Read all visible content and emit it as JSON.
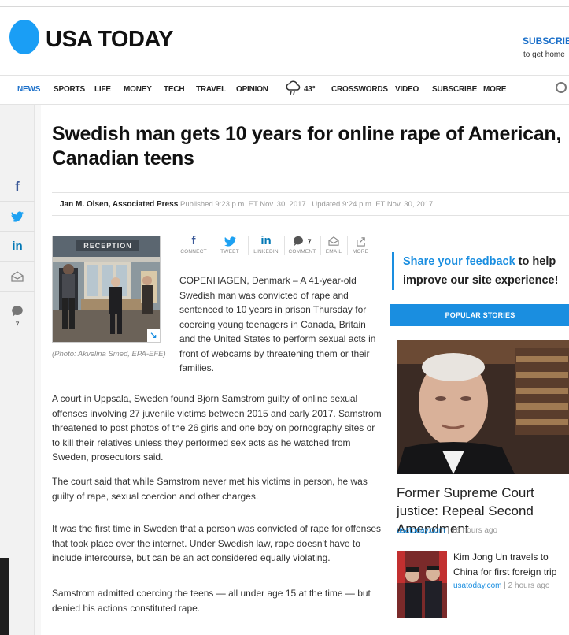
{
  "brand": {
    "name": "USA TODAY"
  },
  "header": {
    "subscribe_label": "SUBSCRIBE",
    "subscribe_sub": "to get home"
  },
  "nav": {
    "items": [
      "NEWS",
      "SPORTS",
      "LIFE",
      "MONEY",
      "TECH",
      "TRAVEL",
      "OPINION",
      "CROSSWORDS",
      "VIDEO",
      "SUBSCRIBE",
      "MORE"
    ],
    "active": "NEWS",
    "weather_temp": "43°"
  },
  "rail": {
    "comment_count": "7"
  },
  "article": {
    "headline": "Swedish man gets 10 years for online rape of American, Canadian teens",
    "author": "Jan M. Olsen, Associated Press",
    "meta": "Published 9:23 p.m. ET Nov. 30, 2017 | Updated 9:24 p.m. ET Nov. 30, 2017",
    "photo_caption": "(Photo: Akvelina Smed, EPA-EFE)",
    "photo_sign": "RECEPTION",
    "share": {
      "connect": "CONNECT",
      "tweet": "TWEET",
      "linkedin": "LINKEDIN",
      "comment": "COMMENT",
      "comment_count": "7",
      "email": "EMAIL",
      "more": "MORE"
    },
    "lede": "COPENHAGEN, Denmark – A 41-year-old Swedish man was convicted of rape and sentenced to 10 years in prison Thursday for coercing young teenagers in Canada, Britain and the United States to perform sexual acts in front of webcams by threatening them or their families.",
    "paragraphs": [
      "A court in Uppsala, Sweden found Bjorn Samstrom guilty of online sexual offenses involving 27 juvenile victims between 2015 and early 2017. Samstrom threatened to post photos of the 26 girls and one boy on pornography sites or to kill their relatives unless they performed sex acts as he watched from Sweden, prosecutors said.",
      "The court said that while Samstrom never met his victims in person, he was guilty of rape, sexual coercion and other charges.",
      "It was the first time in Sweden that a person was convicted of rape for offenses that took place over the internet. Under Swedish law, rape doesn't have to include intercourse, but can be an act considered equally violating.",
      "Samstrom admitted coercing the teens — all under age 15 at the time — but denied his actions constituted rape."
    ]
  },
  "sidebar": {
    "feedback_link": "Share your feedback",
    "feedback_rest": " to help improve our site experience!",
    "popular_header": "POPULAR STORIES",
    "stories": [
      {
        "title": "Former Supreme Court justice: Repeal Second Amendment",
        "source": "usatoday.com",
        "time": "16 hours ago"
      },
      {
        "title": "Kim Jong Un travels to China for first foreign trip",
        "source": "usatoday.com",
        "time": "2 hours ago"
      }
    ]
  },
  "colors": {
    "accent": "#1a8ee0",
    "logo": "#1a9ef5",
    "facebook": "#3b5998",
    "twitter": "#1da1f2",
    "linkedin": "#0077b5"
  }
}
